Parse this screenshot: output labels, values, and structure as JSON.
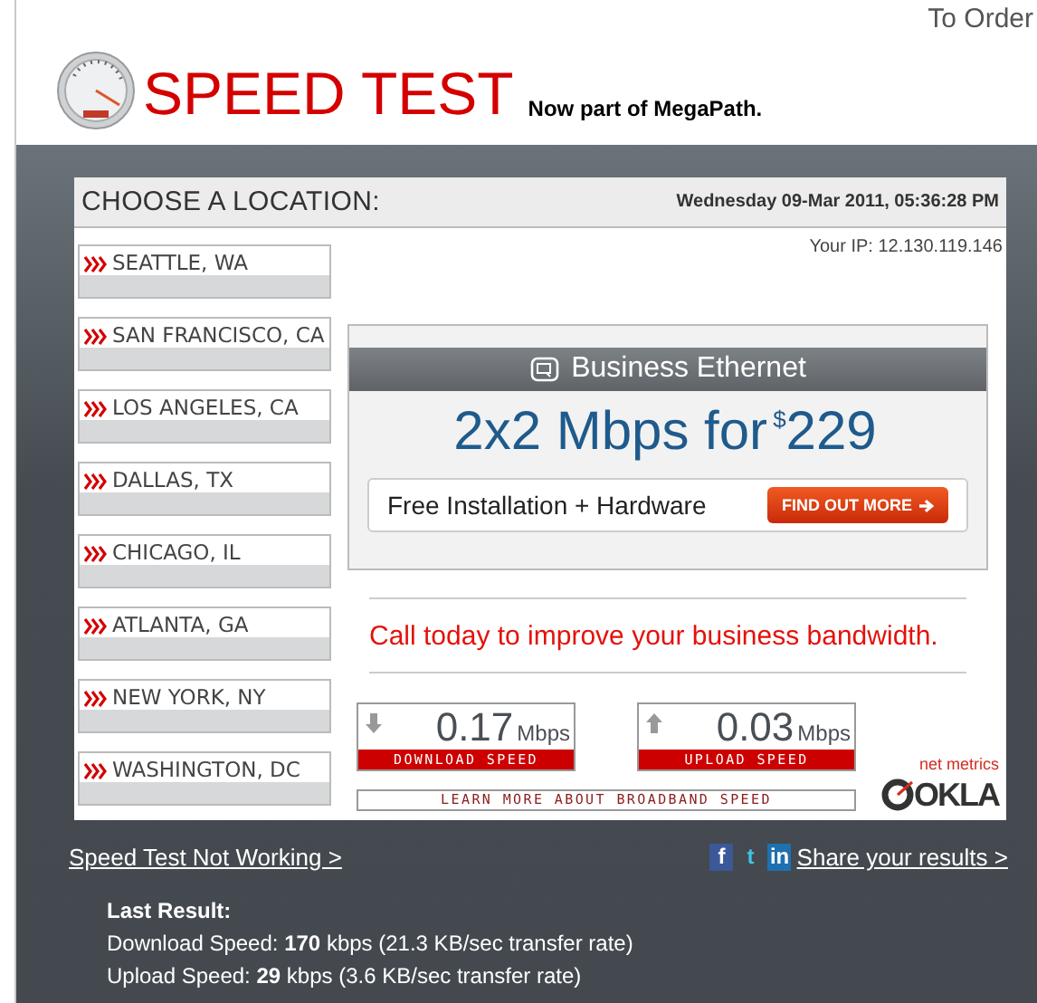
{
  "header": {
    "order_link": "To Order",
    "title": "SPEED TEST",
    "tagline": "Now part of MegaPath."
  },
  "panel": {
    "heading": "CHOOSE A LOCATION:",
    "datetime": "Wednesday 09-Mar 2011, 05:36:28 PM",
    "ip": "Your IP: 12.130.119.146",
    "locations": [
      {
        "label": "SEATTLE, WA"
      },
      {
        "label": "SAN FRANCISCO, CA"
      },
      {
        "label": "LOS ANGELES, CA"
      },
      {
        "label": "DALLAS, TX"
      },
      {
        "label": "CHICAGO, IL"
      },
      {
        "label": "ATLANTA, GA"
      },
      {
        "label": "NEW YORK, NY"
      },
      {
        "label": "WASHINGTON, DC"
      }
    ],
    "ad": {
      "header": "Business Ethernet",
      "offer": "2x2 Mbps for",
      "currency": "$",
      "price": "229",
      "feature": "Free Installation + Hardware",
      "button": "FIND OUT MORE"
    },
    "promo": "Call today to improve your business bandwidth.",
    "results": [
      {
        "kind": "download",
        "value": "0.17",
        "unit": "Mbps",
        "label": "DOWNLOAD SPEED"
      },
      {
        "kind": "upload",
        "value": "0.03",
        "unit": "Mbps",
        "label": "UPLOAD SPEED"
      }
    ],
    "learn_more": "LEARN MORE ABOUT BROADBAND SPEED",
    "logo": {
      "tagline": "net metrics",
      "name": "OKLA"
    }
  },
  "footer": {
    "help_link": "Speed Test Not Working >",
    "social": [
      "f",
      "t",
      "in"
    ],
    "share_link": "Share your results >",
    "last_result": {
      "title": "Last Result:",
      "lines": [
        "Download Speed: **170** kbps (21.3 KB/sec transfer rate)",
        "Upload Speed: **29** kbps (3.6 KB/sec transfer rate)"
      ]
    }
  }
}
